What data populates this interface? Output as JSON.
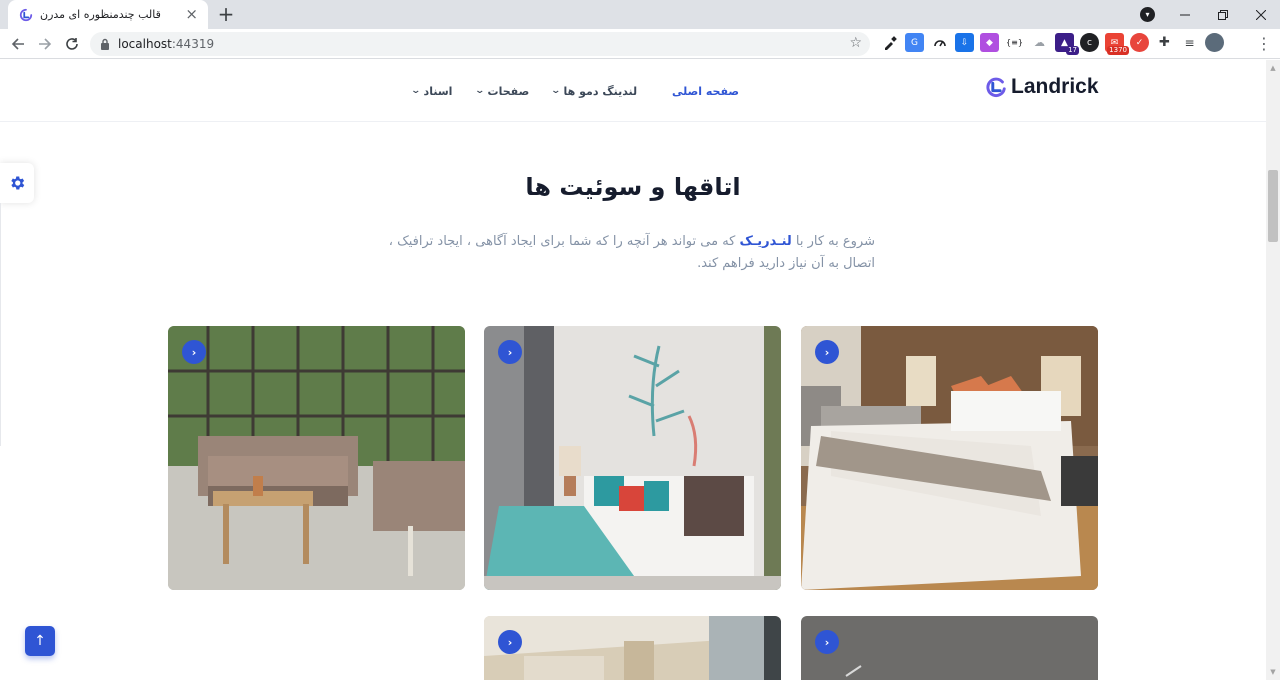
{
  "browser": {
    "tab_title": "قالب چندمنظوره ای مدرن",
    "tab_close": "×",
    "new_tab": "+",
    "url_host": "localhost",
    "url_port": ":44319",
    "extensions": {
      "badge_17": "17",
      "badge_1370": "1370"
    }
  },
  "site": {
    "logo_text": "Landrick",
    "brand_color": "#2f55d4",
    "nav": [
      {
        "label": "صفحه اصلی",
        "active": true
      },
      {
        "label": "لندینگ دمو ها",
        "active": false
      },
      {
        "label": "صفحات",
        "active": false
      },
      {
        "label": "اسناد",
        "active": false
      }
    ]
  },
  "section": {
    "title": "اتاقها و سوئیت ها",
    "subtitle_prefix": "شروع به کار با",
    "subtitle_brand": "لنـدریـک",
    "subtitle_suffix": "که می تواند هر آنچه را که شما برای ایجاد آگاهی ، ایجاد ترافیک ، اتصال به آن نیاز دارید فراهم کند."
  },
  "rooms": [
    {
      "scene": "bedroom with pillows"
    },
    {
      "scene": "bedroom with coral art"
    },
    {
      "scene": "sunroom lounge with sofa"
    },
    {
      "scene": "grey room"
    },
    {
      "scene": "bedroom with window"
    }
  ],
  "icons": {
    "card_arrow": "›",
    "back_to_top": "↑",
    "settings": "gear-icon"
  }
}
